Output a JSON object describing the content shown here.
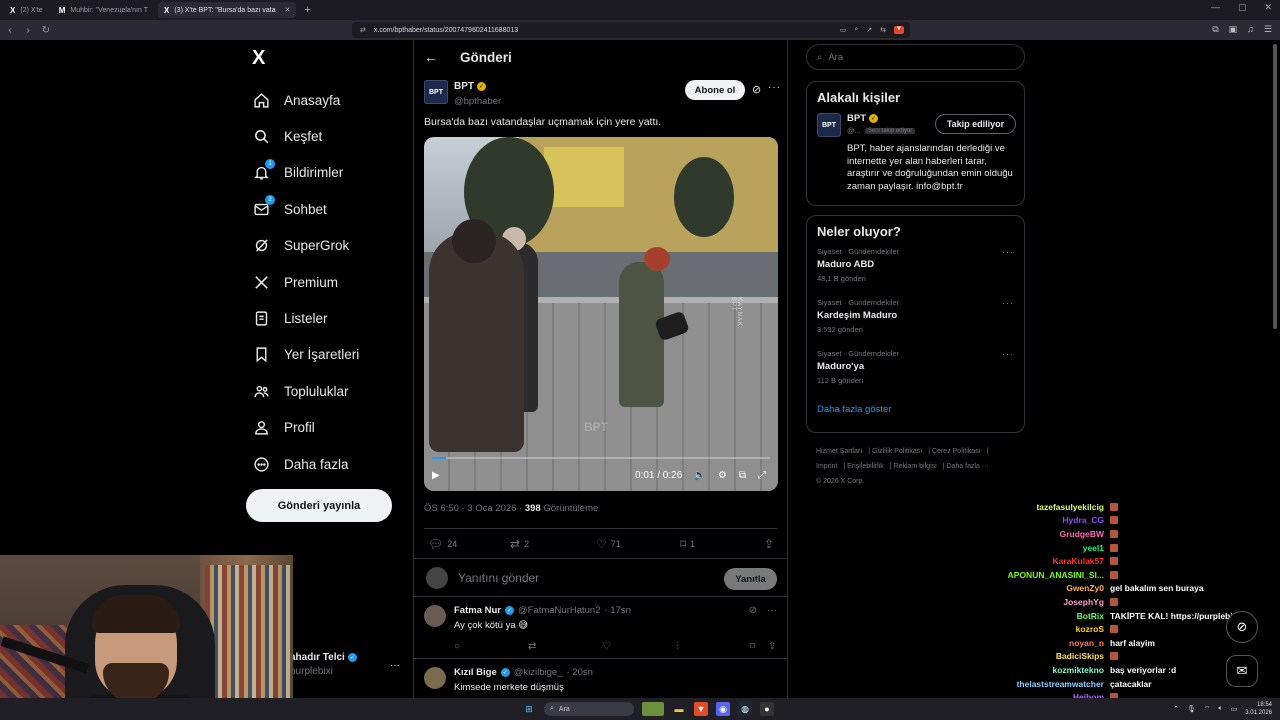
{
  "browser": {
    "tabs": [
      {
        "label": "(2) X'te",
        "active": false
      },
      {
        "label": "Muhbir: \"Venezuela'nın T",
        "active": false
      },
      {
        "label": "(3) X'te BPT: \"Bursa'da bazı vata",
        "active": true
      }
    ],
    "url": "x.com/bpthaber/status/2007479602411688013"
  },
  "nav": {
    "logo": "X",
    "items": [
      {
        "label": "Anasayfa",
        "icon": "home-icon"
      },
      {
        "label": "Keşfet",
        "icon": "search-icon"
      },
      {
        "label": "Bildirimler",
        "icon": "bell-icon",
        "badge": "1"
      },
      {
        "label": "Sohbet",
        "icon": "mail-icon",
        "badge": "2"
      },
      {
        "label": "SuperGrok",
        "icon": "grok-icon"
      },
      {
        "label": "Premium",
        "icon": "x-icon"
      },
      {
        "label": "Listeler",
        "icon": "list-icon"
      },
      {
        "label": "Yer İşaretleri",
        "icon": "bookmark-icon"
      },
      {
        "label": "Topluluklar",
        "icon": "people-icon"
      },
      {
        "label": "Profil",
        "icon": "person-icon"
      },
      {
        "label": "Daha fazla",
        "icon": "more-circle-icon"
      }
    ],
    "post_button": "Gönderi yayınla"
  },
  "account": {
    "name": "ahadır Telci",
    "handle": "purplebixi"
  },
  "main": {
    "header_title": "Gönderi",
    "post": {
      "author_name": "BPT",
      "author_handle": "@bpthaber",
      "avatar_text": "BPT",
      "subscribe_label": "Abone ol",
      "text": "Bursa'da bazı vatandaşlar uçmamak için yere yattı.",
      "video": {
        "time": "0:01 / 0:26",
        "watermark": "KAYNAK: BPT",
        "progress": 0.04
      },
      "meta_time": "ÖS 6:50 · 3 Oca 2026 · ",
      "views_count": "398",
      "views_label": " Görüntüleme",
      "stats": {
        "replies": "24",
        "reposts": "2",
        "likes": "71",
        "bookmarks": "1"
      }
    },
    "reply_placeholder": "Yanıtını gönder",
    "reply_button": "Yanıtla",
    "comments": [
      {
        "name": "Fatma Nur",
        "handle": "@FatmaNurHatun2",
        "time": "· 17sn",
        "text": "Ay çok kötü ya 😅"
      },
      {
        "name": "Kızıl Bige",
        "handle": "@kizilbige_",
        "time": "· 20sn",
        "text": "Kimsede merkete düşmüş"
      }
    ]
  },
  "right": {
    "search_placeholder": "Ara",
    "related": {
      "title": "Alakalı kişiler",
      "name": "BPT",
      "handle": "@...",
      "follows_you": "Seni takip ediyor",
      "follow_button": "Takip ediliyor",
      "bio": "BPT, haber ajanslarından derlediği ve internette yer alan haberleri tarar, araştırır ve doğruluğundan emin olduğu zaman paylaşır. info@bpt.tr"
    },
    "trends": {
      "title": "Neler oluyor?",
      "items": [
        {
          "context": "Siyaset · Gündemdekiler",
          "name": "Maduro ABD",
          "count": "48,1 B gönderi"
        },
        {
          "context": "Siyaset · Gündemdekiler",
          "name": "Kardeşim Maduro",
          "count": "3.592 gönderi"
        },
        {
          "context": "Siyaset · Gündemdekiler",
          "name": "Maduro'ya",
          "count": "112 B gönderi"
        }
      ],
      "show_more": "Daha fazla göster"
    },
    "footer": [
      "Hizmet Şartları",
      "Gizlilik Politikası",
      "Çerez Politikası",
      "Imprint",
      "Erişilebilirlik",
      "Reklam bilgisi",
      "Daha fazla ···",
      "© 2026 X Corp."
    ]
  },
  "chat": [
    {
      "user": "tazefasulyekilcig",
      "color": "#d6ff7a",
      "msg": ""
    },
    {
      "user": "Hydra_CG",
      "color": "#9146ff",
      "msg": ""
    },
    {
      "user": "GrudgeBW",
      "color": "#ff69b4",
      "msg": ""
    },
    {
      "user": "yeel1",
      "color": "#00ff7f",
      "msg": ""
    },
    {
      "user": "KaraKulak57",
      "color": "#ff3030",
      "msg": ""
    },
    {
      "user": "APONUN_ANASINI_SI...",
      "color": "#7cfc00",
      "msg": ""
    },
    {
      "user": "GwenZy0",
      "color": "#ffb347",
      "msg": "gel bakalım sen buraya"
    },
    {
      "user": "JosephYg",
      "color": "#ff9ecb",
      "msg": ""
    },
    {
      "user": "BotRix",
      "color": "#5fff5f",
      "msg": "TAKİPTE KAL! https://purplebixi.tr"
    },
    {
      "user": "kozroS",
      "color": "#ffd700",
      "msg": ""
    },
    {
      "user": "noyan_n",
      "color": "#ff7f50",
      "msg": "harf alayim"
    },
    {
      "user": "BadiciSkips",
      "color": "#ffe066",
      "msg": ""
    },
    {
      "user": "kozmiktekno",
      "color": "#7fffd4",
      "msg": "baş veriyorlar :d"
    },
    {
      "user": "thelaststreamwatcher",
      "color": "#87cefa",
      "msg": "çatacaklar"
    },
    {
      "user": "Heibom",
      "color": "#b266ff",
      "msg": ""
    }
  ],
  "taskbar": {
    "search": "Ara",
    "time": "18:54",
    "date": "3.01.2026"
  }
}
